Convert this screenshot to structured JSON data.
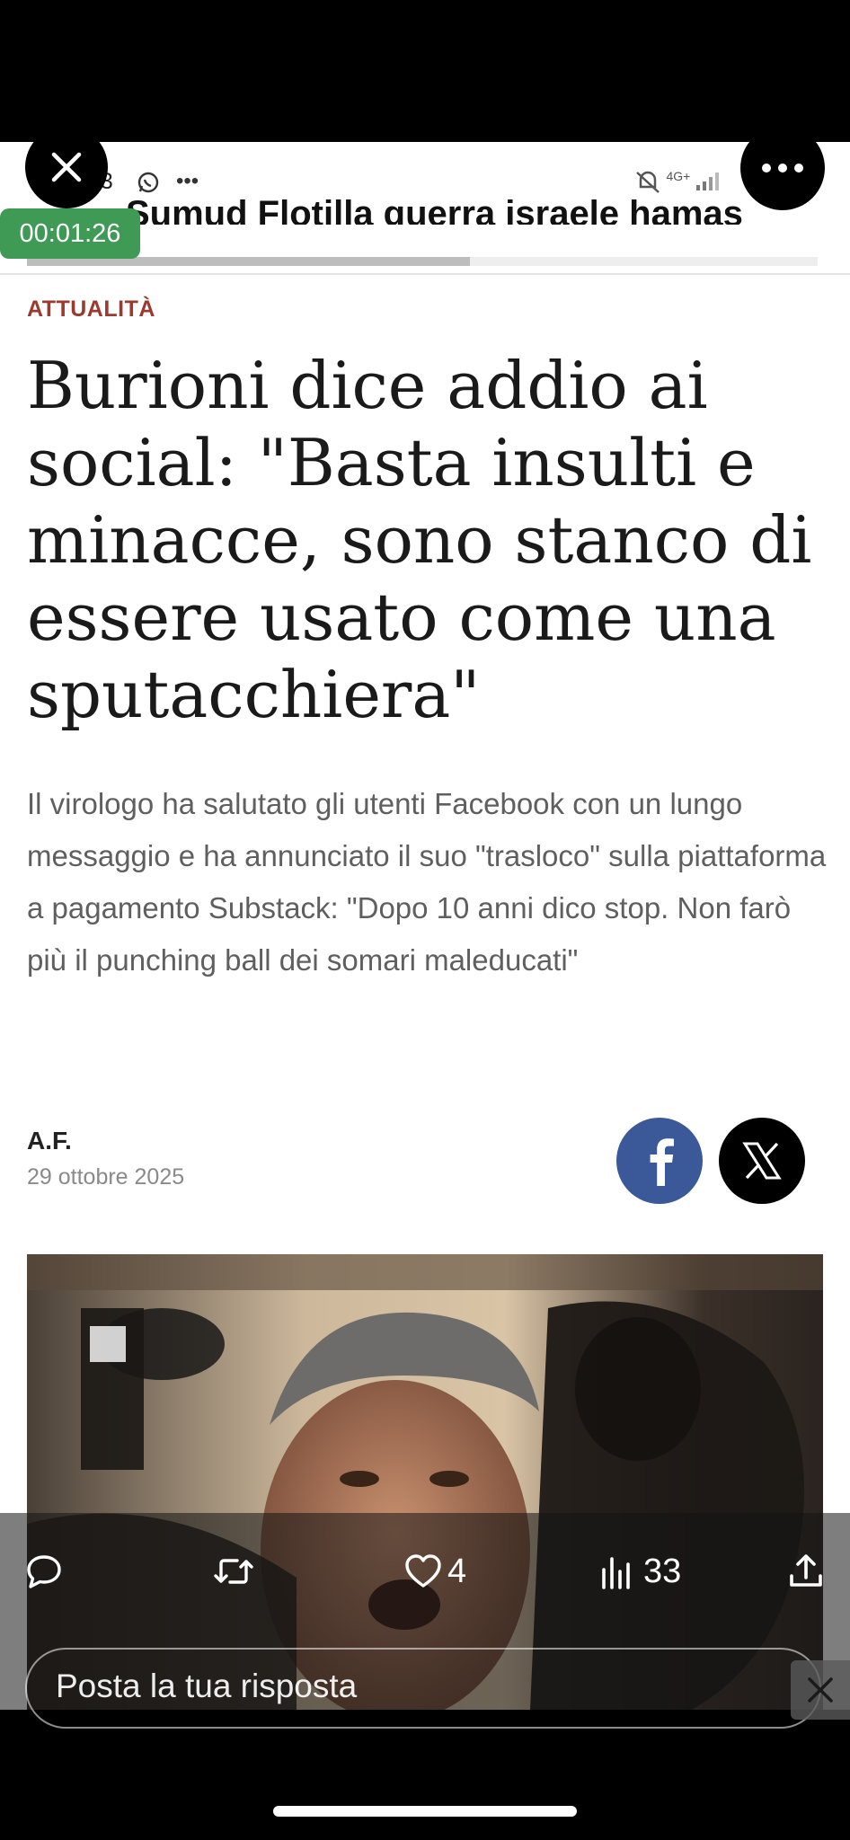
{
  "status_bar": {
    "time_partial": "53",
    "network": "4G+"
  },
  "ticker": {
    "text": "Sumud Flotilla  guerra israele hamas"
  },
  "video_overlay": {
    "timer": "00:01:26"
  },
  "article": {
    "category": "ATTUALITÀ",
    "headline": "Burioni dice addio ai social: \"Basta insulti e minacce, sono stanco di essere usato come una sputacchiera\"",
    "summary": "Il virologo ha salutato gli utenti Facebook con un lungo messaggio e ha annunciato il suo \"trasloco\" sulla piattaforma a pagamento Substack: \"Dopo 10 anni dico stop. Non farò più il punching ball dei somari maleducati\"",
    "author": "A.F.",
    "date": "29 ottobre 2025",
    "scroll_progress": 0.56
  },
  "actions": {
    "likes": "4",
    "views": "33"
  },
  "reply": {
    "placeholder": "Posta la tua risposta"
  },
  "colors": {
    "category": "#9b3a2e",
    "facebook": "#3b5998",
    "timer": "#3e9a54"
  },
  "icons": [
    "close-icon",
    "more-icon",
    "whatsapp-icon",
    "ellipsis-icon",
    "mute-icon",
    "signal-icon",
    "facebook-icon",
    "x-logo-icon",
    "reply-icon",
    "repost-icon",
    "heart-icon",
    "views-icon",
    "share-icon"
  ]
}
